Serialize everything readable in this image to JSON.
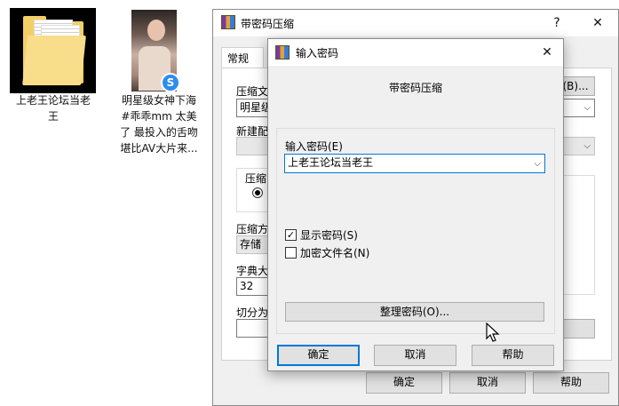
{
  "desktop": {
    "folder_label": "上老王论坛当老\n王",
    "video_label": "明星级女神下海\n#乖乖mm 太美\n了 最投入的舌吻\n堪比AV大片来..."
  },
  "back_window": {
    "title": "带密码压缩",
    "help_char": "?",
    "close_char": "✕",
    "tab_general": "常规",
    "label_archive": "压缩文",
    "browse_btn": "(B)...",
    "archive_value": "明星级",
    "label_profile": "新建配",
    "label_format": "压缩",
    "label_method": "压缩方",
    "method_value": "存储",
    "label_dict": "字典大",
    "dict_value": "32",
    "label_split": "切分为",
    "ok": "确定",
    "cancel": "取消",
    "help": "帮助"
  },
  "dialog": {
    "title": "输入密码",
    "close_char": "✕",
    "heading": "带密码压缩",
    "password_label": "输入密码(E)",
    "password_value": "上老王论坛当老王",
    "show_password": "显示密码(S)",
    "encrypt_filenames": "加密文件名(N)",
    "organize_btn": "整理密码(O)...",
    "ok": "确定",
    "cancel": "取消",
    "help": "帮助",
    "show_password_checked": true,
    "encrypt_filenames_checked": false
  }
}
